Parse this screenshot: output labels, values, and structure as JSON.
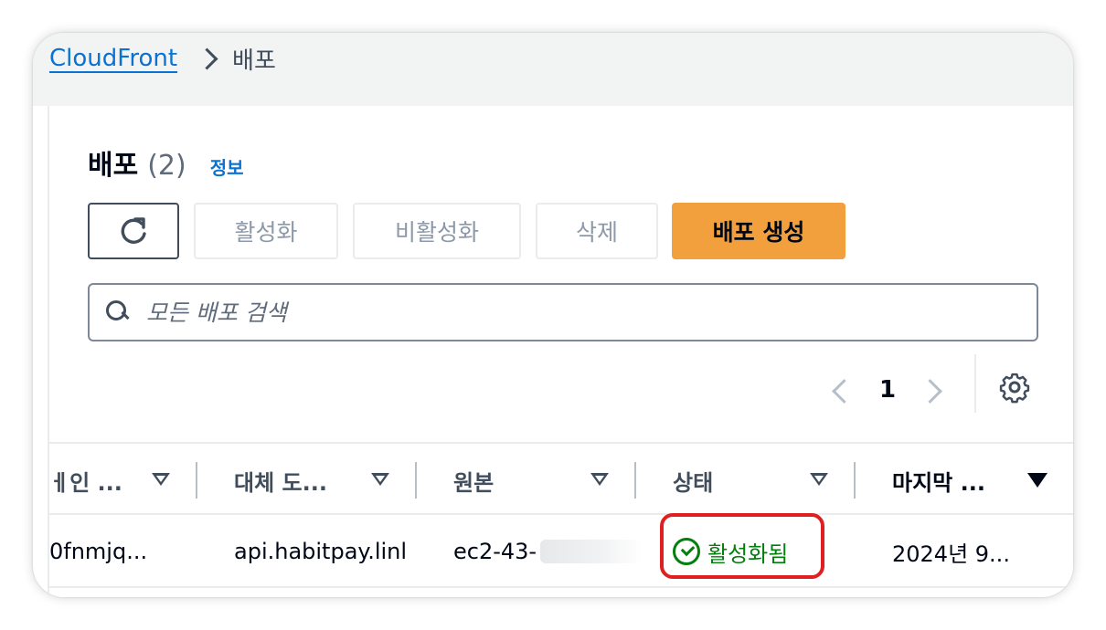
{
  "breadcrumb": {
    "root": "CloudFront",
    "current": "배포"
  },
  "header": {
    "title": "배포",
    "count": "(2)",
    "info": "정보"
  },
  "toolbar": {
    "refresh_icon": "refresh-icon",
    "activate": "활성화",
    "deactivate": "비활성화",
    "delete": "삭제",
    "create": "배포 생성"
  },
  "search": {
    "placeholder": "모든 배포 검색"
  },
  "pagination": {
    "current_page": "1"
  },
  "table": {
    "columns": [
      "메인 ...",
      "대체 도...",
      "원본",
      "상태",
      "마지막 ..."
    ],
    "columns_visible": [
      "\u0000",
      "대체 도...",
      "원본",
      "상태",
      "마지막 ..."
    ],
    "col0": "ㅔ인 ...",
    "row": {
      "domain": "0fnmjq...",
      "alternate_domain": "api.habitpay.linl",
      "origin": "ec2-43-",
      "status": "활성화됨",
      "last_modified": "2024년 9..."
    }
  },
  "colors": {
    "accent": "#0972d3",
    "primary_button": "#f29f3d",
    "status_ok": "#037f0c",
    "highlight": "#e02020"
  }
}
